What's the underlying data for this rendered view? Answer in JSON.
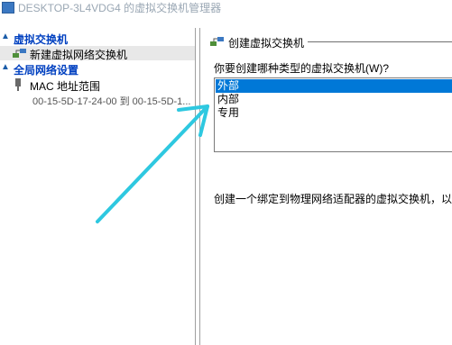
{
  "window": {
    "title": "DESKTOP-3L4VDG4 的虚拟交换机管理器"
  },
  "sidebar": {
    "virtual_switches_header": "虚拟交换机",
    "new_switch_item": "新建虚拟网络交换机",
    "global_settings_header": "全局网络设置",
    "mac_range_item": "MAC 地址范围",
    "mac_range_value": "00-15-5D-17-24-00 到 00-15-5D-1..."
  },
  "main": {
    "group_title": "创建虚拟交换机",
    "question": "你要创建哪种类型的虚拟交换机(W)?",
    "switch_types": [
      "外部",
      "内部",
      "专用"
    ],
    "selected_type": "外部",
    "description": "创建一个绑定到物理网络适配器的虚拟交换机，以便虚拟机可以访问物理网络。"
  },
  "colors": {
    "accent": "#0078d7",
    "header_link": "#0040c0",
    "annotation_arrow": "#2ec8e0"
  }
}
